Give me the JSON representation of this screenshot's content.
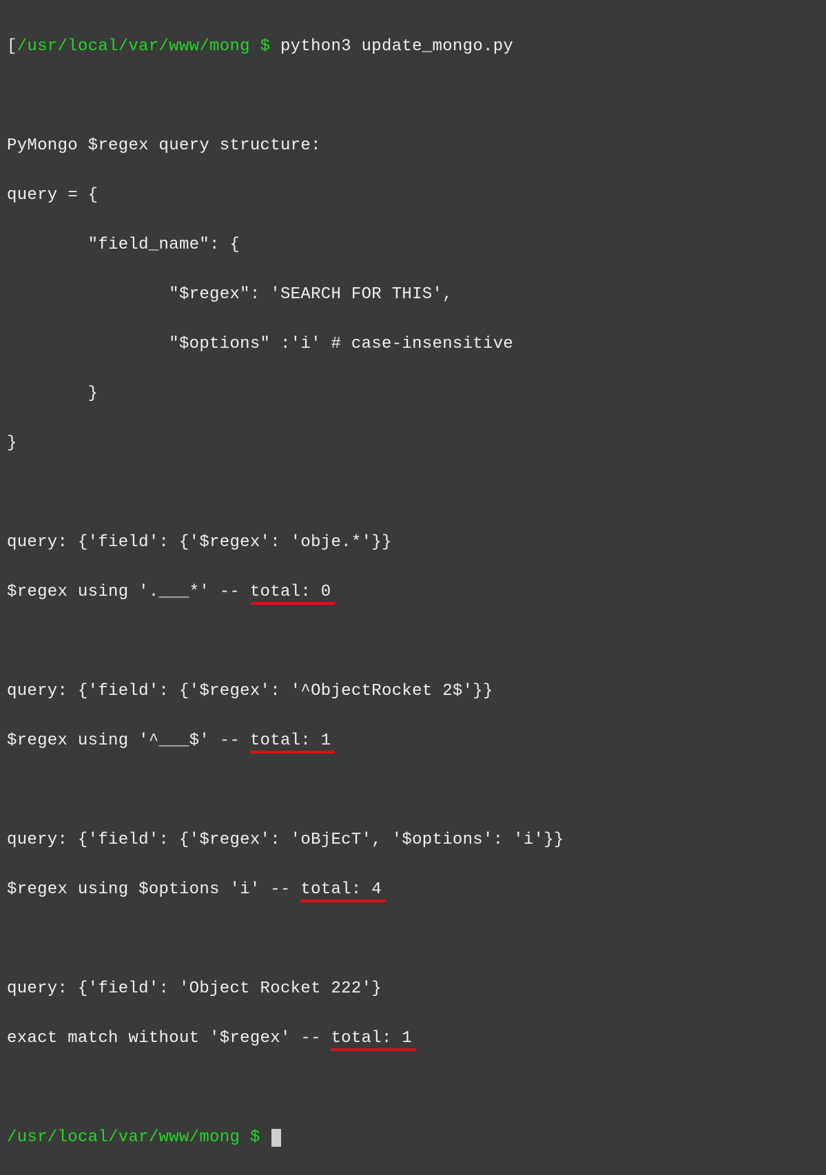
{
  "prompt1": {
    "bracket": "[",
    "path": "/usr/local/var/www/mong",
    "sep": " $ ",
    "command": "python3 update_mongo.py"
  },
  "structure": {
    "l1": "PyMongo $regex query structure:",
    "l2": "query = {",
    "l3": "        \"field_name\": {",
    "l4": "                \"$regex\": 'SEARCH FOR THIS',",
    "l5": "                \"$options\" :'i' # case-insensitive",
    "l6": "        }",
    "l7": "}"
  },
  "q1": {
    "line": "query: {'field': {'$regex': 'obje.*'}}",
    "prefix": "$regex using '.___*' -- ",
    "result": "total: 0"
  },
  "q2": {
    "line": "query: {'field': {'$regex': '^ObjectRocket 2$'}}",
    "prefix": "$regex using '^___$' -- ",
    "result": "total: 1"
  },
  "q3": {
    "line": "query: {'field': {'$regex': 'oBjEcT', '$options': 'i'}}",
    "prefix": "$regex using $options 'i' -- ",
    "result": "total: 4"
  },
  "q4": {
    "line": "query: {'field': 'Object Rocket 222'}",
    "prefix": "exact match without '$regex' -- ",
    "result": "total: 1"
  },
  "prompt2": {
    "path": "/usr/local/var/www/mong",
    "sep": " $ "
  }
}
